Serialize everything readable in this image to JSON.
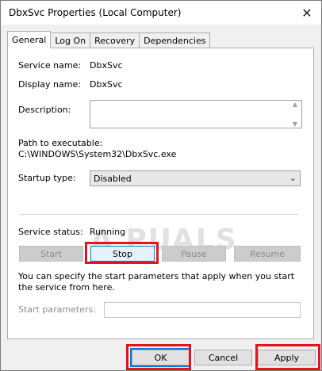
{
  "window": {
    "title": "DbxSvc Properties (Local Computer)"
  },
  "tabs": [
    "General",
    "Log On",
    "Recovery",
    "Dependencies"
  ],
  "general": {
    "service_name_label": "Service name:",
    "service_name": "DbxSvc",
    "display_name_label": "Display name:",
    "display_name": "DbxSvc",
    "description_label": "Description:",
    "path_label": "Path to executable:",
    "path": "C:\\WINDOWS\\System32\\DbxSvc.exe",
    "startup_type_label": "Startup type:",
    "startup_type": "Disabled",
    "status_label": "Service status:",
    "status": "Running",
    "buttons": {
      "start": "Start",
      "stop": "Stop",
      "pause": "Pause",
      "resume": "Resume"
    },
    "info": "You can specify the start parameters that apply when you start the service from here.",
    "start_params_label": "Start parameters:",
    "start_params_value": ""
  },
  "watermark": "A PUALS",
  "footer": {
    "ok": "OK",
    "cancel": "Cancel",
    "apply": "Apply"
  },
  "colors": {
    "highlight": "#e5131b",
    "focus": "#0078d7"
  }
}
